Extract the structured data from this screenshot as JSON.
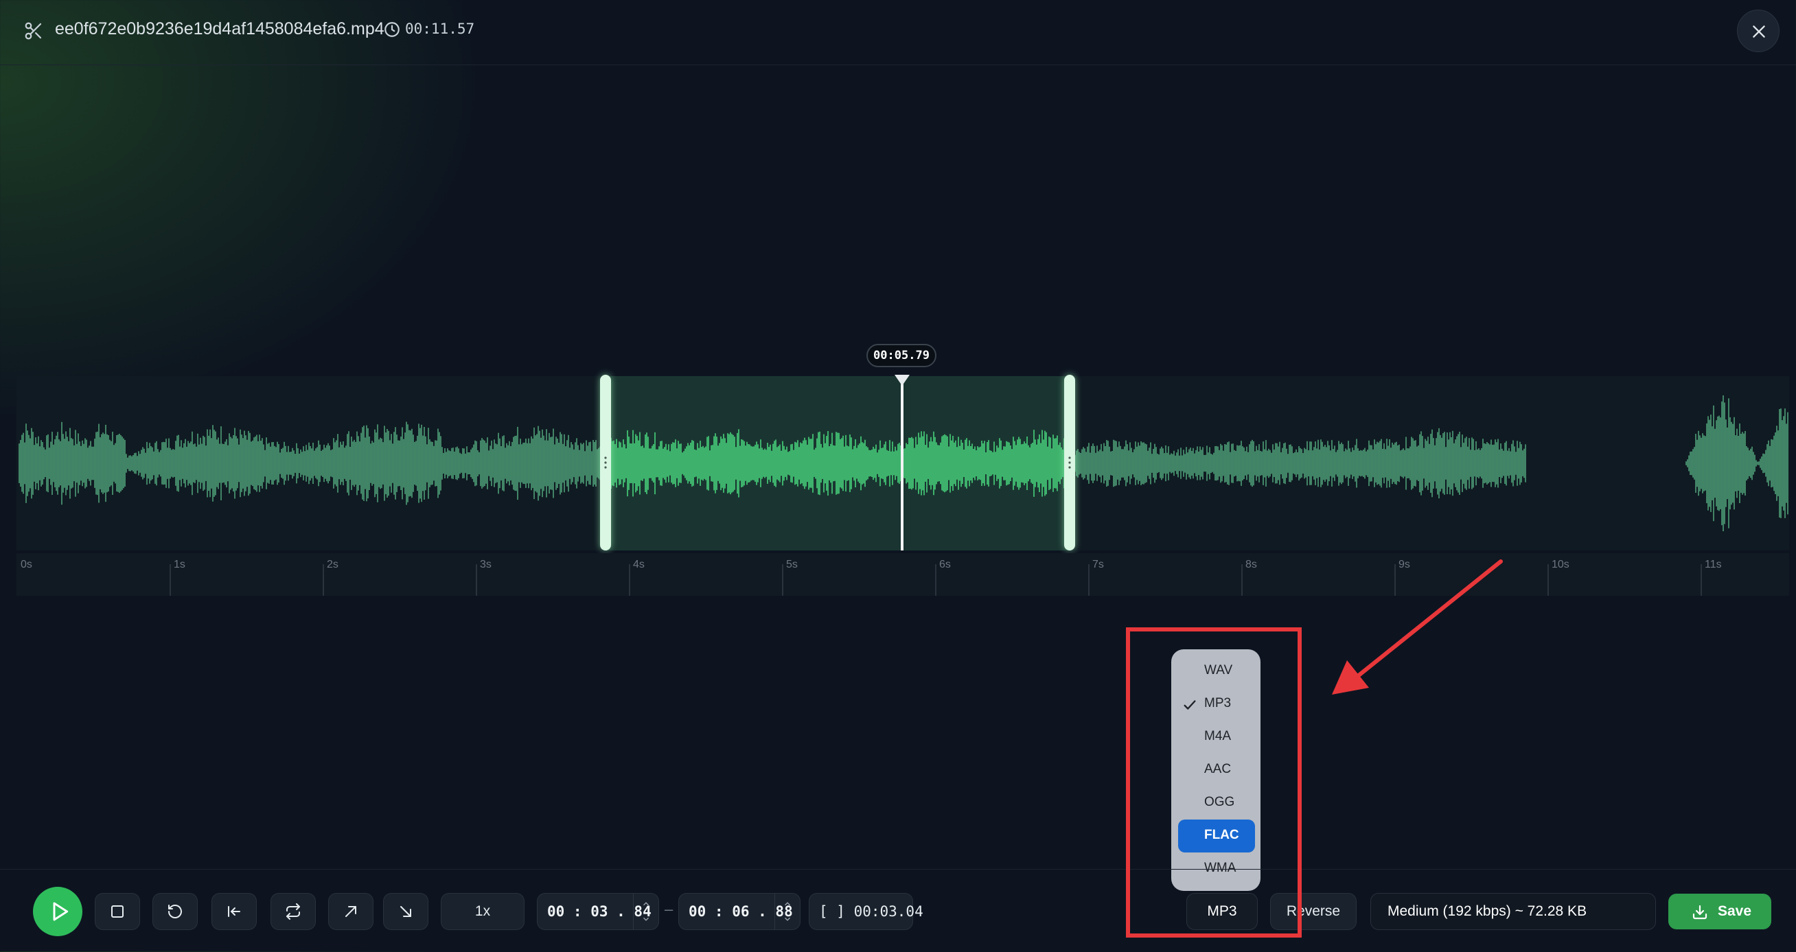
{
  "header": {
    "filename": "ee0f672e0b9236e19d4af1458084efa6.mp4",
    "duration": "00:11.57",
    "icons": [
      "scissors-icon",
      "clock-icon",
      "close-icon"
    ]
  },
  "waveform": {
    "playhead_time": "00:05.79",
    "playhead_seconds": 5.79,
    "selection_start_seconds": 3.84,
    "selection_end_seconds": 6.88,
    "total_seconds": 11.57,
    "ruler_labels": [
      "0s",
      "1s",
      "2s",
      "3s",
      "4s",
      "5s",
      "6s",
      "7s",
      "8s",
      "9s",
      "10s",
      "11s"
    ],
    "colors": {
      "wave": "#4e9e77",
      "wave_selected": "#47d37a",
      "selection": "#50c882"
    }
  },
  "format_menu": {
    "items": [
      "WAV",
      "MP3",
      "M4A",
      "AAC",
      "OGG",
      "FLAC",
      "WMA"
    ],
    "checked": "MP3",
    "highlighted": "FLAC",
    "highlight_color": "#1768d2"
  },
  "controls": {
    "speed": "1x",
    "start_time": "00 : 03 . 84",
    "end_time": "00 : 06 . 88",
    "range_separator": "–",
    "selection_duration": "[ ] 00:03.04",
    "format": "MP3",
    "reverse_label": "Reverse",
    "quality": "Medium (192 kbps) ~ 72.28 KB",
    "save_label": "Save",
    "accent_color": "#2ebd5b"
  }
}
